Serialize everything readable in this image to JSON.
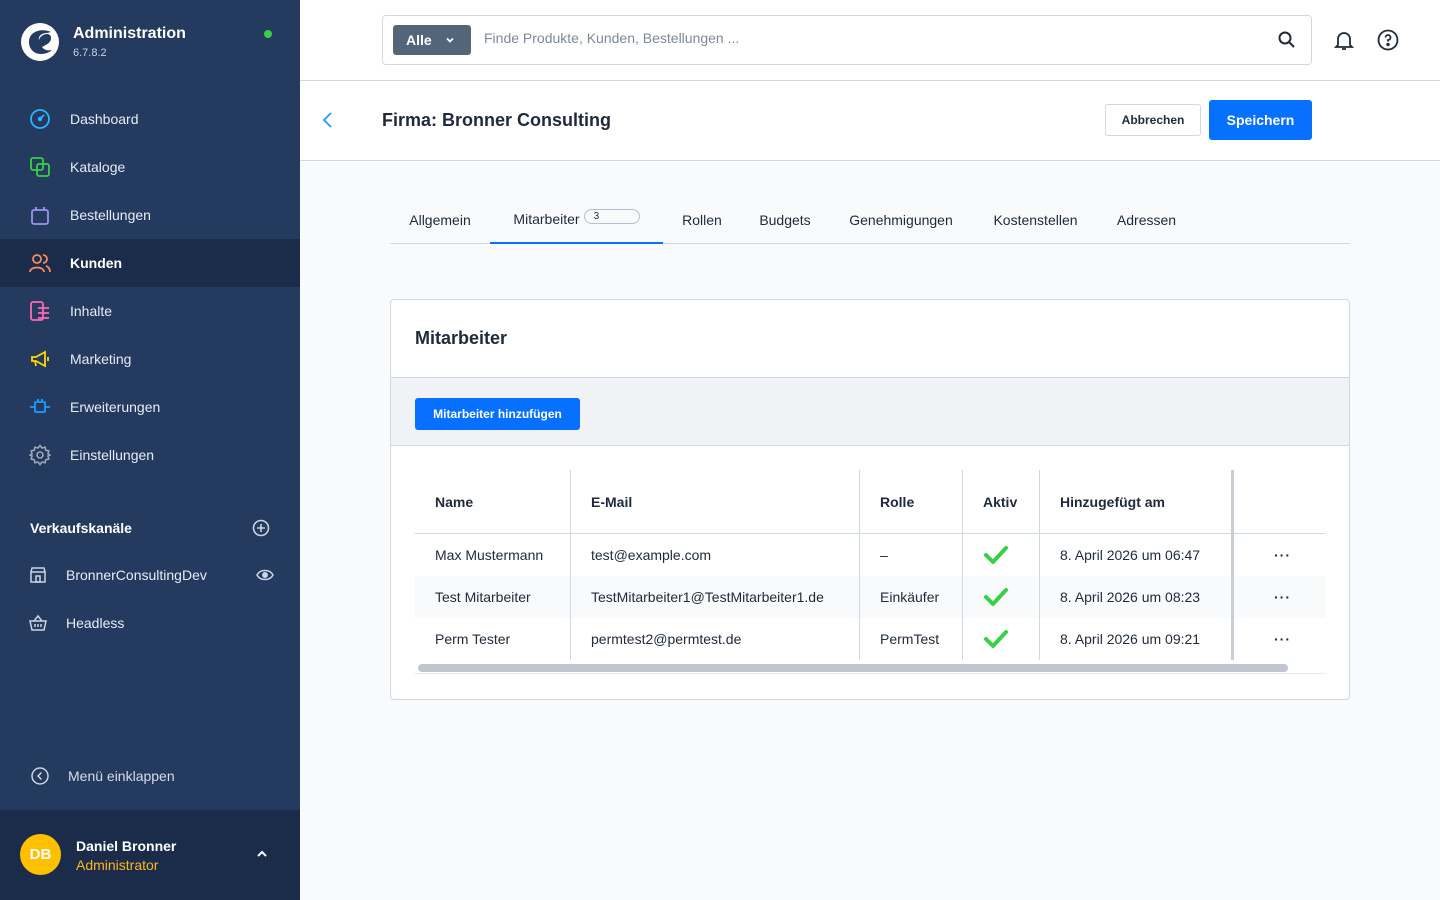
{
  "app": {
    "title": "Administration",
    "version": "6.7.8.2"
  },
  "colors": {
    "sidebar": "#243a5e",
    "accent": "#0870ff",
    "success": "#37d046",
    "warning": "#ffb61e"
  },
  "nav": [
    {
      "label": "Dashboard",
      "icon": "dashboard-icon",
      "color": "#2bb5ff"
    },
    {
      "label": "Kataloge",
      "icon": "catalog-icon",
      "color": "#37d046"
    },
    {
      "label": "Bestellungen",
      "icon": "orders-icon",
      "color": "#a092f0"
    },
    {
      "label": "Kunden",
      "icon": "customers-icon",
      "color": "#f88962",
      "active": true
    },
    {
      "label": "Inhalte",
      "icon": "content-icon",
      "color": "#ff68b4"
    },
    {
      "label": "Marketing",
      "icon": "marketing-icon",
      "color": "#ffd700"
    },
    {
      "label": "Erweiterungen",
      "icon": "extensions-icon",
      "color": "#189eff"
    },
    {
      "label": "Einstellungen",
      "icon": "settings-icon",
      "color": "#9aa8b5"
    }
  ],
  "sales_channels": {
    "heading": "Verkaufskanäle",
    "items": [
      {
        "label": "BronnerConsultingDev",
        "icon": "storefront-icon"
      },
      {
        "label": "Headless",
        "icon": "basket-icon"
      }
    ]
  },
  "collapse_label": "Menü einklappen",
  "user": {
    "initials": "DB",
    "name": "Daniel Bronner",
    "role": "Administrator"
  },
  "search": {
    "type": "Alle",
    "placeholder": "Finde Produkte, Kunden, Bestellungen ..."
  },
  "page": {
    "title": "Firma: Bronner Consulting",
    "cancel": "Abbrechen",
    "save": "Speichern"
  },
  "tabs": [
    {
      "label": "Allgemein"
    },
    {
      "label": "Mitarbeiter",
      "badge": "3",
      "active": true
    },
    {
      "label": "Rollen"
    },
    {
      "label": "Budgets"
    },
    {
      "label": "Genehmigungen"
    },
    {
      "label": "Kostenstellen"
    },
    {
      "label": "Adressen"
    }
  ],
  "card": {
    "title": "Mitarbeiter",
    "add_button": "Mitarbeiter hinzufügen",
    "columns": [
      "Name",
      "E-Mail",
      "Rolle",
      "Aktiv",
      "Hinzugefügt am"
    ],
    "rows": [
      {
        "name": "Max Mustermann",
        "email": "test@example.com",
        "role": "–",
        "active": true,
        "added": "8. April 2026 um 06:47"
      },
      {
        "name": "Test Mitarbeiter",
        "email": "TestMitarbeiter1@TestMitarbeiter1.de",
        "role": "Einkäufer",
        "active": true,
        "added": "8. April 2026 um 08:23"
      },
      {
        "name": "Perm Tester",
        "email": "permtest2@permtest.de",
        "role": "PermTest",
        "active": true,
        "added": "8. April 2026 um 09:21"
      }
    ],
    "row_actions": "···"
  }
}
